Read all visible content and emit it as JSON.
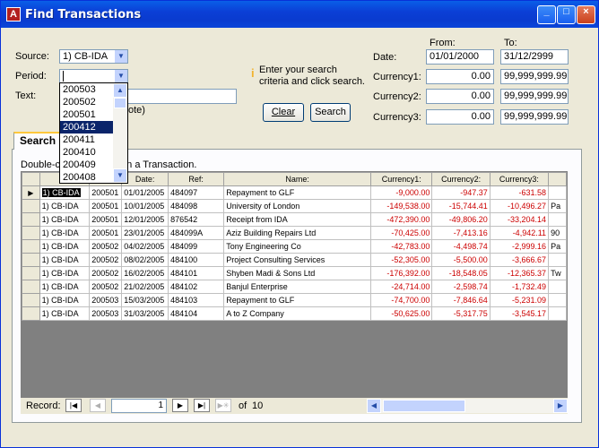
{
  "window": {
    "title": "Find Transactions",
    "app_icon": "A"
  },
  "form": {
    "source_label": "Source:",
    "source_value": "1) CB-IDA",
    "period_label": "Period:",
    "period_value": "",
    "text_label": "Text:",
    "text_value": "",
    "note_fragment": "ote)",
    "hint": "Enter your search criteria and click search.",
    "hint_line1": "Enter your search",
    "hint_line2": "criteria and click search.",
    "clear_label": "Clear",
    "search_label": "Search",
    "from_label": "From:",
    "to_label": "To:",
    "date_label": "Date:",
    "date_from": "01/01/2000",
    "date_to": "31/12/2999",
    "currency1_label": "Currency1:",
    "currency1_from": "0.00",
    "currency1_to": "99,999,999.99",
    "currency2_label": "Currency2:",
    "currency2_from": "0.00",
    "currency2_to": "99,999,999.99",
    "currency3_label": "Currency3:",
    "currency3_from": "0.00",
    "currency3_to": "99,999,999.99"
  },
  "period_dropdown": {
    "items": [
      "200503",
      "200502",
      "200501",
      "200412",
      "200411",
      "200410",
      "200409",
      "200408"
    ],
    "selected": "200412"
  },
  "tab": {
    "label": "Search"
  },
  "hint_prefix": "Double-c",
  "hint_suffix": "en a Transaction.",
  "grid": {
    "columns": [
      "So",
      "",
      "Date:",
      "Ref:",
      "Name:",
      "Currency1:",
      "Currency2:",
      "Currency3:",
      ""
    ],
    "rows": [
      [
        "1) CB-IDA",
        "200501",
        "01/01/2005",
        "484097",
        "Repayment to GLF",
        "-9,000.00",
        "-947.37",
        "-631.58",
        ""
      ],
      [
        "1) CB-IDA",
        "200501",
        "10/01/2005",
        "484098",
        "University of London",
        "-149,538.00",
        "-15,744.41",
        "-10,496.27",
        "Pa"
      ],
      [
        "1) CB-IDA",
        "200501",
        "12/01/2005",
        "876542",
        "Receipt from IDA",
        "-472,390.00",
        "-49,806.20",
        "-33,204.14",
        ""
      ],
      [
        "1) CB-IDA",
        "200501",
        "23/01/2005",
        "484099A",
        "Aziz Building Repairs Ltd",
        "-70,425.00",
        "-7,413.16",
        "-4,942.11",
        "90"
      ],
      [
        "1) CB-IDA",
        "200502",
        "04/02/2005",
        "484099",
        "Tony Engineering Co",
        "-42,783.00",
        "-4,498.74",
        "-2,999.16",
        "Pa"
      ],
      [
        "1) CB-IDA",
        "200502",
        "08/02/2005",
        "484100",
        "Project Consulting Services",
        "-52,305.00",
        "-5,500.00",
        "-3,666.67",
        ""
      ],
      [
        "1) CB-IDA",
        "200502",
        "16/02/2005",
        "484101",
        "Shyben Madi & Sons Ltd",
        "-176,392.00",
        "-18,548.05",
        "-12,365.37",
        "Tw"
      ],
      [
        "1) CB-IDA",
        "200502",
        "21/02/2005",
        "484102",
        "Banjul Enterprise",
        "-24,714.00",
        "-2,598.74",
        "-1,732.49",
        ""
      ],
      [
        "1) CB-IDA",
        "200503",
        "15/03/2005",
        "484103",
        "Repayment to GLF",
        "-74,700.00",
        "-7,846.64",
        "-5,231.09",
        ""
      ],
      [
        "1) CB-IDA",
        "200503",
        "31/03/2005",
        "484104",
        "A to Z Company",
        "-50,625.00",
        "-5,317.75",
        "-3,545.17",
        ""
      ]
    ]
  },
  "nav": {
    "record_label": "Record:",
    "current": "1",
    "of_label": "of",
    "total": "10"
  }
}
